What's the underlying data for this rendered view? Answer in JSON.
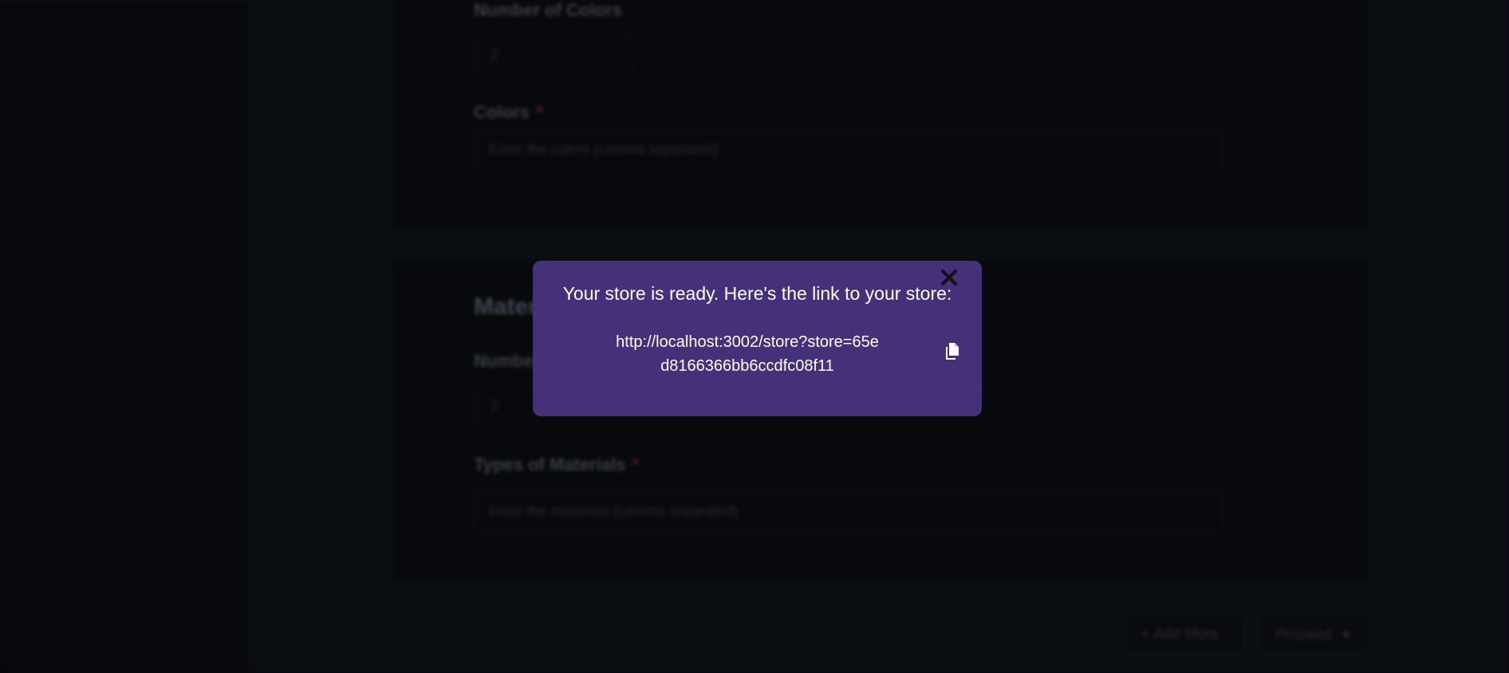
{
  "form": {
    "colors_section": {
      "number_label": "Number of Colors",
      "number_value": "2",
      "colors_label": "Colors",
      "colors_required_mark": "*",
      "colors_placeholder": "Enter the colors (comma separated)"
    },
    "materials_section": {
      "title": "Materials",
      "number_label": "Number of Materials",
      "number_value": "2",
      "types_label": "Types of Materials",
      "types_required_mark": "*",
      "types_placeholder": "Enter the materials (comma separated)"
    },
    "buttons": {
      "add_more": "+ Add More",
      "proceed": "Proceed"
    }
  },
  "modal": {
    "title": "Your store is ready. Here's the link to your store:",
    "link": "http://localhost:3002/store?store=65ed8166366bb6ccdfc08f11",
    "close_icon": "close-icon",
    "copy_icon": "copy-icon"
  },
  "colors": {
    "modal_background": "#45307a",
    "page_background": "#0b0d13"
  }
}
